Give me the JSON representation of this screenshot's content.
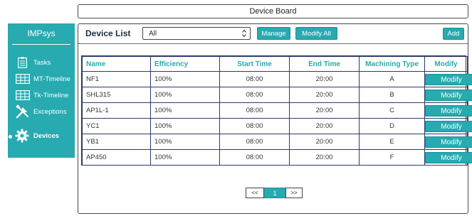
{
  "header": {
    "title": "Device Board"
  },
  "sidebar": {
    "brand": "IMPsys",
    "items": [
      {
        "label": "Tasks",
        "icon": "clipboard-icon"
      },
      {
        "label": "MT-Timeline",
        "icon": "grid-icon"
      },
      {
        "label": "Tk-Timeline",
        "icon": "grid-icon"
      },
      {
        "label": "Exceptions",
        "icon": "wrench-screwdriver-icon"
      },
      {
        "label": "Devices",
        "icon": "gear-icon",
        "active": true
      }
    ]
  },
  "toolbar": {
    "title": "Device List",
    "filter_value": "All",
    "manage_label": "Manage",
    "modify_all_label": "Modify All",
    "add_label": "Add"
  },
  "table": {
    "columns": [
      "Name",
      "Efficiency",
      "Start Time",
      "End Time",
      "Machining Type",
      "Modify"
    ],
    "rows": [
      {
        "name": "NF1",
        "efficiency": "100%",
        "start": "08:00",
        "end": "20:00",
        "type": "A",
        "action": "Modify"
      },
      {
        "name": "SHL315",
        "efficiency": "100%",
        "start": "08:00",
        "end": "20:00",
        "type": "B",
        "action": "Modify"
      },
      {
        "name": "AP1L-1",
        "efficiency": "100%",
        "start": "08:00",
        "end": "20:00",
        "type": "C",
        "action": "Modify"
      },
      {
        "name": "YC1",
        "efficiency": "100%",
        "start": "08:00",
        "end": "20:00",
        "type": "D",
        "action": "Modify"
      },
      {
        "name": "YB1",
        "efficiency": "100%",
        "start": "08:00",
        "end": "20:00",
        "type": "E",
        "action": "Modify"
      },
      {
        "name": "AP450",
        "efficiency": "100%",
        "start": "08:00",
        "end": "20:00",
        "type": "F",
        "action": "Modify"
      }
    ]
  },
  "pagination": {
    "prev": "<<",
    "current": "1",
    "next": ">>"
  },
  "colors": {
    "accent": "#27aab0",
    "border": "#2a3a6b"
  }
}
